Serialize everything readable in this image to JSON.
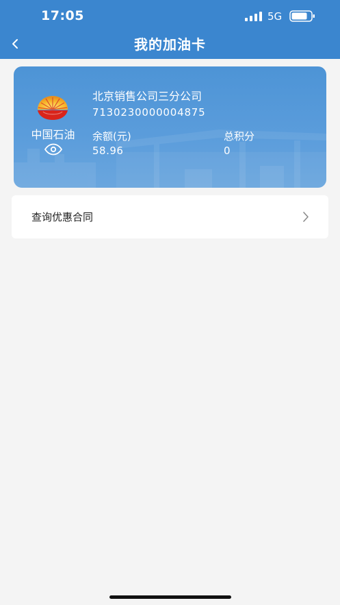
{
  "status_bar": {
    "time": "17:05",
    "network": "5G",
    "icons": [
      "signal-icon",
      "battery-icon"
    ]
  },
  "nav": {
    "title": "我的加油卡",
    "back_icon": "chevron-left-icon"
  },
  "card": {
    "brand": "中国石油",
    "logo_icon": "petrochina-logo-icon",
    "visibility_icon": "eye-icon",
    "company": "北京销售公司三分公司",
    "number": "7130230000004875",
    "balance_label": "余额(元)",
    "balance_value": "58.96",
    "points_label": "总积分",
    "points_value": "0"
  },
  "menu": {
    "items": [
      {
        "label": "查询优惠合同",
        "icon": "chevron-right-icon"
      }
    ]
  },
  "colors": {
    "header": "#3b86cf",
    "card": "#5a9cdb",
    "page_bg": "#f4f4f4"
  }
}
